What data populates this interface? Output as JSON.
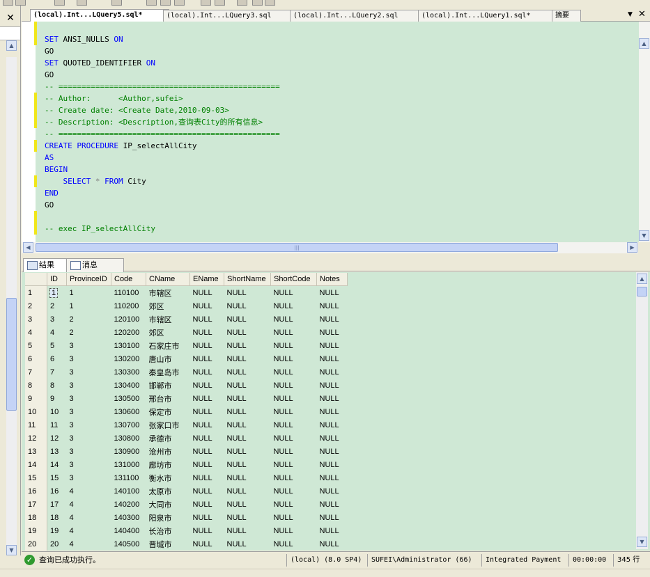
{
  "left_panel": {
    "close_label": "✕"
  },
  "tabs": [
    {
      "label": "(local).Int...LQuery5.sql*",
      "active": true
    },
    {
      "label": "(local).Int...LQuery3.sql"
    },
    {
      "label": "(local).Int...LQuery2.sql"
    },
    {
      "label": "(local).Int...LQuery1.sql*"
    },
    {
      "label": "摘要"
    }
  ],
  "tab_controls": {
    "dropdown": "▼",
    "close": "✕"
  },
  "editor": {
    "lines": [
      {
        "kw1": "SET",
        "t1": " ANSI_NULLS ",
        "kw2": "ON"
      },
      {
        "t1": "GO"
      },
      {
        "kw1": "SET",
        "t1": " QUOTED_IDENTIFIER ",
        "kw2": "ON"
      },
      {
        "t1": "GO"
      },
      {
        "cm": "-- ================================================"
      },
      {
        "cm": "-- Author:      <Author,sufei>"
      },
      {
        "cm": "-- Create date: <Create Date,2010-09-03>"
      },
      {
        "cm": "-- Description: <Description,查询表City的所有信息>"
      },
      {
        "cm": "-- ================================================"
      },
      {
        "kw1": "CREATE PROCEDURE",
        "t1": " IP_selectAllCity"
      },
      {
        "kw1": "AS"
      },
      {
        "kw1": "BEGIN"
      },
      {
        "indent": "    ",
        "kw1": "SELECT",
        "g1": " * ",
        "kw2": "FROM",
        "t2": " City"
      },
      {
        "kw1": "END"
      },
      {
        "t1": "GO"
      },
      {},
      {
        "cm": "-- exec IP_selectAllCity"
      }
    ]
  },
  "results_tabs": [
    {
      "label": "结果",
      "active": true
    },
    {
      "label": "消息"
    }
  ],
  "grid": {
    "columns": [
      "",
      "ID",
      "ProvinceID",
      "Code",
      "CName",
      "EName",
      "ShortName",
      "ShortCode",
      "Notes"
    ],
    "rows": [
      [
        "1",
        "1",
        "1",
        "110100",
        "市辖区",
        "NULL",
        "NULL",
        "NULL",
        "NULL"
      ],
      [
        "2",
        "2",
        "1",
        "110200",
        "郊区",
        "NULL",
        "NULL",
        "NULL",
        "NULL"
      ],
      [
        "3",
        "3",
        "2",
        "120100",
        "市辖区",
        "NULL",
        "NULL",
        "NULL",
        "NULL"
      ],
      [
        "4",
        "4",
        "2",
        "120200",
        "郊区",
        "NULL",
        "NULL",
        "NULL",
        "NULL"
      ],
      [
        "5",
        "5",
        "3",
        "130100",
        "石家庄市",
        "NULL",
        "NULL",
        "NULL",
        "NULL"
      ],
      [
        "6",
        "6",
        "3",
        "130200",
        "唐山市",
        "NULL",
        "NULL",
        "NULL",
        "NULL"
      ],
      [
        "7",
        "7",
        "3",
        "130300",
        "秦皇岛市",
        "NULL",
        "NULL",
        "NULL",
        "NULL"
      ],
      [
        "8",
        "8",
        "3",
        "130400",
        "邯郸市",
        "NULL",
        "NULL",
        "NULL",
        "NULL"
      ],
      [
        "9",
        "9",
        "3",
        "130500",
        "邢台市",
        "NULL",
        "NULL",
        "NULL",
        "NULL"
      ],
      [
        "10",
        "10",
        "3",
        "130600",
        "保定市",
        "NULL",
        "NULL",
        "NULL",
        "NULL"
      ],
      [
        "11",
        "11",
        "3",
        "130700",
        "张家口市",
        "NULL",
        "NULL",
        "NULL",
        "NULL"
      ],
      [
        "12",
        "12",
        "3",
        "130800",
        "承德市",
        "NULL",
        "NULL",
        "NULL",
        "NULL"
      ],
      [
        "13",
        "13",
        "3",
        "130900",
        "沧州市",
        "NULL",
        "NULL",
        "NULL",
        "NULL"
      ],
      [
        "14",
        "14",
        "3",
        "131000",
        "廊坊市",
        "NULL",
        "NULL",
        "NULL",
        "NULL"
      ],
      [
        "15",
        "15",
        "3",
        "131100",
        "衡水市",
        "NULL",
        "NULL",
        "NULL",
        "NULL"
      ],
      [
        "16",
        "16",
        "4",
        "140100",
        "太原市",
        "NULL",
        "NULL",
        "NULL",
        "NULL"
      ],
      [
        "17",
        "17",
        "4",
        "140200",
        "大同市",
        "NULL",
        "NULL",
        "NULL",
        "NULL"
      ],
      [
        "18",
        "18",
        "4",
        "140300",
        "阳泉市",
        "NULL",
        "NULL",
        "NULL",
        "NULL"
      ],
      [
        "19",
        "19",
        "4",
        "140400",
        "长治市",
        "NULL",
        "NULL",
        "NULL",
        "NULL"
      ],
      [
        "20",
        "20",
        "4",
        "140500",
        "晋城市",
        "NULL",
        "NULL",
        "NULL",
        "NULL"
      ]
    ]
  },
  "status": {
    "message": "查询已成功执行。",
    "server": "(local) (8.0 SP4)",
    "user": "SUFEI\\Administrator (66)",
    "database": "Integrated Payment",
    "elapsed": "00:00:00",
    "rows": "345 行"
  },
  "icons": {
    "status_ok": "check-circle-icon",
    "scroll_up": "arrow-up-icon",
    "scroll_down": "arrow-down-icon",
    "scroll_left": "arrow-left-icon",
    "scroll_right": "arrow-right-icon"
  },
  "colors": {
    "editor_background": "#cfe8d5",
    "keyword": "#0000ff",
    "comment": "#008000",
    "change_marker": "#f0e61a",
    "status_ok": "#2f9a2f"
  }
}
